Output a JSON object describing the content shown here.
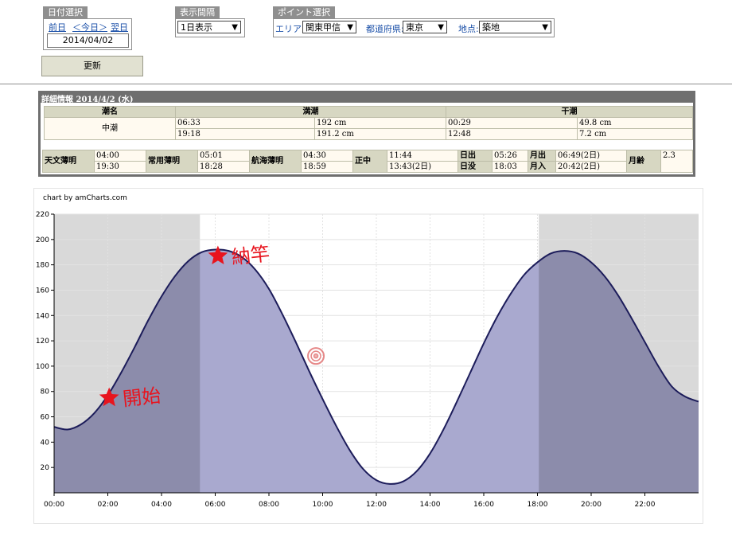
{
  "date_box": {
    "title": "日付選択",
    "prev": "前日",
    "today": "＜今日＞",
    "next": "翌日",
    "date": "2014/04/02"
  },
  "interval_box": {
    "title": "表示間隔",
    "selected": "1日表示"
  },
  "point_box": {
    "title": "ポイント選択",
    "area_label": "エリア:",
    "area": "関東甲信",
    "pref_label": "都道府県:",
    "pref": "東京",
    "loc_label": "地点:",
    "loc": "築地"
  },
  "update_button": "更新",
  "details": {
    "title": "詳細情報 2014/4/2 (水)",
    "tide_head": [
      "潮名",
      "満潮",
      "干潮"
    ],
    "tide_name": "中潮",
    "high": [
      {
        "time": "06:33",
        "level": "192 cm"
      },
      {
        "time": "19:18",
        "level": "191.2 cm"
      }
    ],
    "low": [
      {
        "time": "00:29",
        "level": "49.8 cm"
      },
      {
        "time": "12:48",
        "level": "7.2 cm"
      }
    ],
    "astro": {
      "l_astro": "天文薄明",
      "astro1": "04:00",
      "astro2": "19:30",
      "l_civil": "常用薄明",
      "civil1": "05:01",
      "civil2": "18:28",
      "l_naut": "航海薄明",
      "naut1": "04:30",
      "naut2": "18:59",
      "l_noon": "正中",
      "noon1": "11:44",
      "noon2": "13:43(2日)",
      "l_sunrise": "日出",
      "sunrise": "05:26",
      "l_sunset": "日没",
      "sunset": "18:03",
      "l_moonrise": "月出",
      "moonrise": "06:49(2日)",
      "l_moonset": "月入",
      "moonset": "20:42(2日)",
      "l_moonage": "月齢",
      "moonage": "2.3"
    }
  },
  "chart_credit": "chart by amCharts.com",
  "annotations": {
    "start": "開始",
    "end": "納竿"
  },
  "colors": {
    "tide_line": "#1c1c5a",
    "tide_fill_day": "#a9a9cf",
    "tide_fill_night": "#8c8cab",
    "night_bg": "#d9d9d9",
    "star": "#e8141e"
  },
  "chart_data": {
    "type": "area",
    "x_unit": "hours",
    "xlim": [
      0,
      24
    ],
    "ylim": [
      0,
      220
    ],
    "x_ticks": [
      "00:00",
      "02:00",
      "04:00",
      "06:00",
      "08:00",
      "10:00",
      "12:00",
      "14:00",
      "16:00",
      "18:00",
      "20:00",
      "22:00"
    ],
    "y_ticks": [
      20,
      40,
      60,
      80,
      100,
      120,
      140,
      160,
      180,
      200,
      220
    ],
    "grid": true,
    "night_shading": [
      [
        0,
        5.43
      ],
      [
        18.05,
        24
      ]
    ],
    "x": [
      0,
      0.5,
      1,
      1.5,
      2,
      2.5,
      3,
      3.5,
      4,
      4.5,
      5,
      5.5,
      6,
      6.5,
      7,
      7.5,
      8,
      8.5,
      9,
      9.5,
      10,
      10.5,
      11,
      11.5,
      12,
      12.5,
      13,
      13.5,
      14,
      14.5,
      15,
      15.5,
      16,
      16.5,
      17,
      17.5,
      18,
      18.5,
      19,
      19.5,
      20,
      20.5,
      21,
      21.5,
      22,
      22.5,
      23,
      23.5,
      24
    ],
    "values": [
      52,
      50,
      54,
      63,
      77,
      95,
      115,
      136,
      155,
      171,
      183,
      190,
      192,
      191,
      186,
      176,
      161,
      141,
      119,
      96,
      74,
      53,
      34,
      19,
      10,
      7,
      9,
      17,
      31,
      50,
      72,
      95,
      118,
      139,
      157,
      172,
      182,
      189,
      191,
      189,
      182,
      171,
      156,
      138,
      119,
      100,
      84,
      76,
      72
    ],
    "markers": [
      {
        "label": "開始",
        "x": 2.05,
        "y": 75
      },
      {
        "label": "納竿",
        "x": 6.1,
        "y": 187
      }
    ]
  }
}
